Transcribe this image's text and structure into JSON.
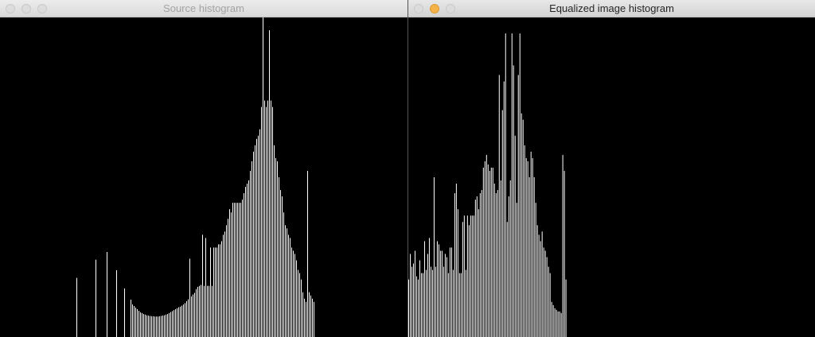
{
  "windows": [
    {
      "id": "source",
      "title": "Source histogram",
      "active": false,
      "chart_data": {
        "type": "bar",
        "bins": 256,
        "y_max": 1.0,
        "values": [
          0,
          0,
          0,
          0,
          0,
          0,
          0,
          0,
          0,
          0,
          0,
          0,
          0,
          0,
          0,
          0,
          0,
          0,
          0,
          0,
          0,
          0,
          0,
          0,
          0,
          0,
          0,
          0,
          0,
          0,
          0,
          0,
          0,
          0,
          0,
          0,
          0,
          0,
          0,
          0,
          0,
          0,
          0,
          0,
          0,
          0,
          0,
          0,
          0.185,
          0,
          0,
          0,
          0,
          0,
          0,
          0,
          0,
          0,
          0,
          0,
          0.242,
          0,
          0,
          0,
          0,
          0,
          0,
          0.266,
          0,
          0,
          0,
          0,
          0,
          0.209,
          0,
          0,
          0,
          0,
          0.152,
          0,
          0,
          0,
          0.117,
          0.102,
          0.097,
          0.092,
          0.087,
          0.082,
          0.077,
          0.075,
          0.072,
          0.07,
          0.068,
          0.067,
          0.066,
          0.065,
          0.065,
          0.064,
          0.064,
          0.064,
          0.065,
          0.066,
          0.067,
          0.068,
          0.07,
          0.072,
          0.075,
          0.078,
          0.081,
          0.084,
          0.087,
          0.09,
          0.093,
          0.095,
          0.098,
          0.102,
          0.106,
          0.112,
          0.118,
          0.245,
          0.127,
          0.133,
          0.138,
          0.15,
          0.157,
          0.16,
          0.163,
          0.32,
          0.16,
          0.31,
          0.16,
          0.16,
          0.28,
          0.16,
          0.28,
          0.28,
          0.28,
          0.29,
          0.29,
          0.3,
          0.32,
          0.33,
          0.35,
          0.37,
          0.4,
          0.39,
          0.42,
          0.42,
          0.42,
          0.42,
          0.42,
          0.42,
          0.43,
          0.45,
          0.47,
          0.48,
          0.49,
          0.52,
          0.55,
          0.58,
          0.6,
          0.62,
          0.63,
          0.65,
          0.72,
          1.0,
          0.74,
          0.72,
          0.74,
          0.96,
          0.74,
          0.72,
          0.6,
          0.56,
          0.55,
          0.5,
          0.46,
          0.44,
          0.39,
          0.35,
          0.34,
          0.32,
          0.31,
          0.28,
          0.27,
          0.26,
          0.24,
          0.21,
          0.2,
          0.18,
          0.14,
          0.12,
          0.11,
          0.52,
          0.14,
          0.13,
          0.12,
          0.11,
          0,
          0,
          0,
          0,
          0,
          0,
          0,
          0,
          0,
          0,
          0,
          0,
          0,
          0,
          0,
          0,
          0,
          0,
          0,
          0,
          0,
          0,
          0,
          0,
          0,
          0,
          0,
          0,
          0,
          0,
          0,
          0,
          0,
          0,
          0,
          0,
          0,
          0,
          0,
          0,
          0,
          0,
          0,
          0,
          0,
          0,
          0,
          0,
          0
        ]
      }
    },
    {
      "id": "equalized",
      "title": "Equalized image histogram",
      "active": true,
      "chart_data": {
        "type": "bar",
        "bins": 256,
        "y_max": 1.0,
        "values": [
          0.18,
          0.26,
          0.22,
          0.23,
          0.27,
          0.19,
          0.18,
          0.24,
          0.2,
          0.2,
          0.3,
          0.21,
          0.26,
          0.31,
          0.22,
          0.21,
          0.5,
          0.22,
          0.3,
          0.29,
          0.27,
          0.27,
          0.22,
          0.26,
          0.25,
          0.2,
          0.28,
          0.28,
          0.21,
          0.45,
          0.48,
          0.4,
          0.2,
          0.2,
          0.36,
          0.38,
          0.21,
          0.38,
          0.35,
          0.38,
          0.38,
          0.38,
          0.43,
          0.44,
          0.4,
          0.45,
          0.46,
          0.53,
          0.55,
          0.57,
          0.54,
          0.52,
          0.53,
          0.53,
          0.48,
          0.45,
          0.46,
          0.82,
          0.49,
          0.71,
          0.8,
          0.95,
          0.36,
          0.44,
          0.49,
          0.95,
          0.85,
          0.63,
          0.42,
          0.82,
          0.95,
          0.7,
          0.68,
          0.6,
          0.56,
          0.55,
          0.5,
          0.58,
          0.56,
          0.5,
          0.42,
          0.35,
          0.32,
          0.3,
          0.33,
          0.28,
          0.27,
          0.25,
          0.22,
          0.2,
          0.11,
          0.1,
          0.09,
          0.085,
          0.08,
          0.08,
          0.075,
          0.57,
          0.52,
          0.18,
          0,
          0,
          0,
          0,
          0,
          0,
          0,
          0,
          0,
          0,
          0,
          0,
          0,
          0,
          0,
          0,
          0,
          0,
          0,
          0,
          0,
          0,
          0,
          0,
          0,
          0,
          0,
          0,
          0,
          0,
          0,
          0,
          0,
          0,
          0,
          0,
          0,
          0,
          0,
          0,
          0,
          0,
          0,
          0,
          0,
          0,
          0,
          0,
          0,
          0,
          0,
          0,
          0,
          0,
          0,
          0,
          0,
          0,
          0,
          0,
          0,
          0,
          0,
          0,
          0,
          0,
          0,
          0,
          0,
          0,
          0,
          0,
          0,
          0,
          0,
          0,
          0,
          0,
          0,
          0,
          0,
          0,
          0,
          0,
          0,
          0,
          0,
          0,
          0,
          0,
          0,
          0,
          0,
          0,
          0,
          0,
          0,
          0,
          0,
          0,
          0,
          0,
          0,
          0,
          0,
          0,
          0,
          0,
          0,
          0,
          0,
          0,
          0,
          0,
          0,
          0,
          0,
          0,
          0,
          0,
          0,
          0,
          0,
          0,
          0,
          0,
          0,
          0,
          0,
          0,
          0,
          0,
          0,
          0,
          0,
          0,
          0,
          0,
          0,
          0,
          0,
          0,
          0,
          0,
          0,
          0,
          0,
          0,
          0,
          0,
          0,
          0,
          0,
          0,
          0,
          0,
          0,
          0,
          0,
          0,
          0,
          0,
          0,
          0,
          0,
          0,
          0,
          0,
          0,
          0,
          0,
          0,
          0,
          0
        ]
      }
    }
  ],
  "colors": {
    "bar": "#ffffff",
    "background": "#000000",
    "minimize_active": "#f6b24a"
  }
}
